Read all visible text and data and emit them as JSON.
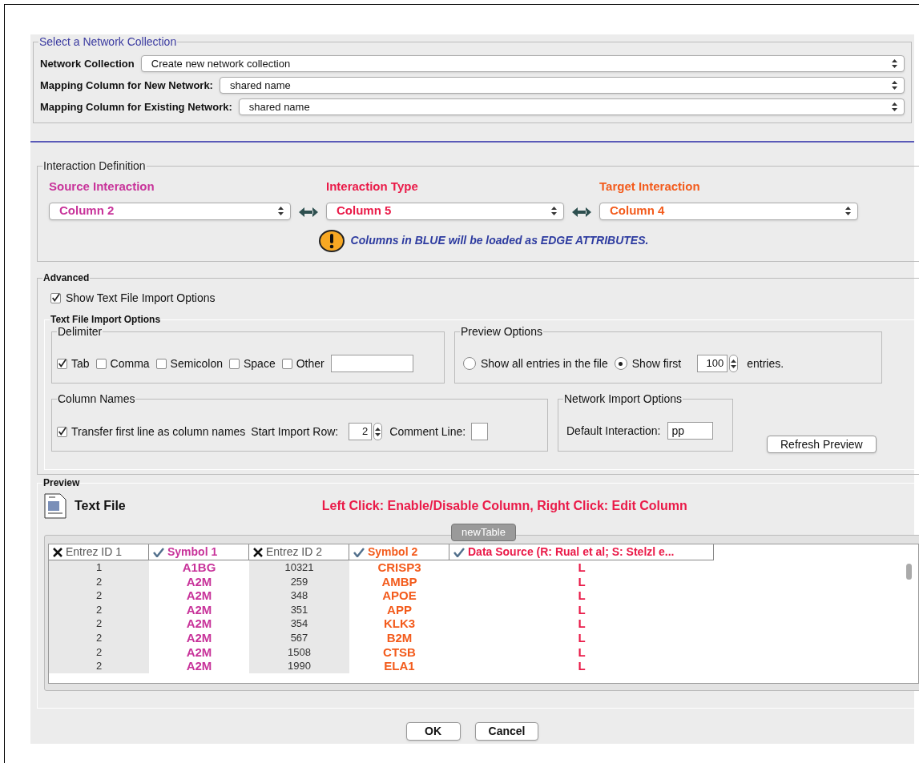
{
  "network_collection": {
    "legend": "Select a Network Collection",
    "fields": [
      {
        "label": "Network Collection",
        "value": "Create new network collection"
      },
      {
        "label": "Mapping Column for New Network:",
        "value": "shared name"
      },
      {
        "label": "Mapping Column for Existing Network:",
        "value": "shared name"
      }
    ]
  },
  "interaction_definition": {
    "legend": "Interaction Definition",
    "selectors": [
      {
        "label": "Source Interaction",
        "value": "Column 2",
        "color": "#c8339a"
      },
      {
        "label": "Interaction Type",
        "value": "Column 5",
        "color": "#ea1a48"
      },
      {
        "label": "Target Interaction",
        "value": "Column 4",
        "color": "#f35b1c"
      }
    ],
    "warning": "Columns in BLUE will be loaded as EDGE ATTRIBUTES."
  },
  "advanced": {
    "legend": "Advanced",
    "show_options": {
      "label": "Show Text File Import Options",
      "checked": true
    },
    "options_legend": "Text File Import Options",
    "delimiter": {
      "legend": "Delimiter",
      "options": [
        {
          "label": "Tab",
          "checked": true
        },
        {
          "label": "Comma",
          "checked": false
        },
        {
          "label": "Semicolon",
          "checked": false
        },
        {
          "label": "Space",
          "checked": false
        },
        {
          "label": "Other",
          "checked": false
        }
      ]
    },
    "preview_options": {
      "legend": "Preview Options",
      "radios": [
        {
          "label": "Show all entries in the file",
          "selected": false
        },
        {
          "label": "Show first",
          "selected": true
        }
      ],
      "count": "100",
      "suffix": "entries."
    },
    "column_names": {
      "legend": "Column Names",
      "transfer": {
        "label": "Transfer first line as column names",
        "checked": true
      },
      "start_label": "Start Import Row:",
      "start_value": "2",
      "comment_label": "Comment Line:"
    },
    "network_import": {
      "legend": "Network Import Options",
      "label": "Default Interaction:",
      "value": "pp"
    },
    "refresh_button": "Refresh Preview"
  },
  "preview": {
    "legend": "Preview",
    "file_title": "Text File",
    "hint": "Left Click: Enable/Disable Column, Right Click: Edit Column",
    "table_tab": "newTable",
    "table": {
      "columns": [
        {
          "label": "Entrez ID 1",
          "enabled": false,
          "color": "#555555"
        },
        {
          "label": "Symbol 1",
          "enabled": true,
          "color": "#c8339a"
        },
        {
          "label": "Entrez ID 2",
          "enabled": false,
          "color": "#555555"
        },
        {
          "label": "Symbol 2",
          "enabled": true,
          "color": "#f35b1c"
        },
        {
          "label": "Data Source (R: Rual et al; S: Stelzl e...",
          "enabled": true,
          "color": "#ea1a48"
        }
      ],
      "rows": [
        [
          "1",
          "A1BG",
          "10321",
          "CRISP3",
          "L"
        ],
        [
          "2",
          "A2M",
          "259",
          "AMBP",
          "L"
        ],
        [
          "2",
          "A2M",
          "348",
          "APOE",
          "L"
        ],
        [
          "2",
          "A2M",
          "351",
          "APP",
          "L"
        ],
        [
          "2",
          "A2M",
          "354",
          "KLK3",
          "L"
        ],
        [
          "2",
          "A2M",
          "567",
          "B2M",
          "L"
        ],
        [
          "2",
          "A2M",
          "1508",
          "CTSB",
          "L"
        ],
        [
          "2",
          "A2M",
          "1990",
          "ELA1",
          "L"
        ]
      ]
    }
  },
  "buttons": [
    "OK",
    "Cancel"
  ]
}
